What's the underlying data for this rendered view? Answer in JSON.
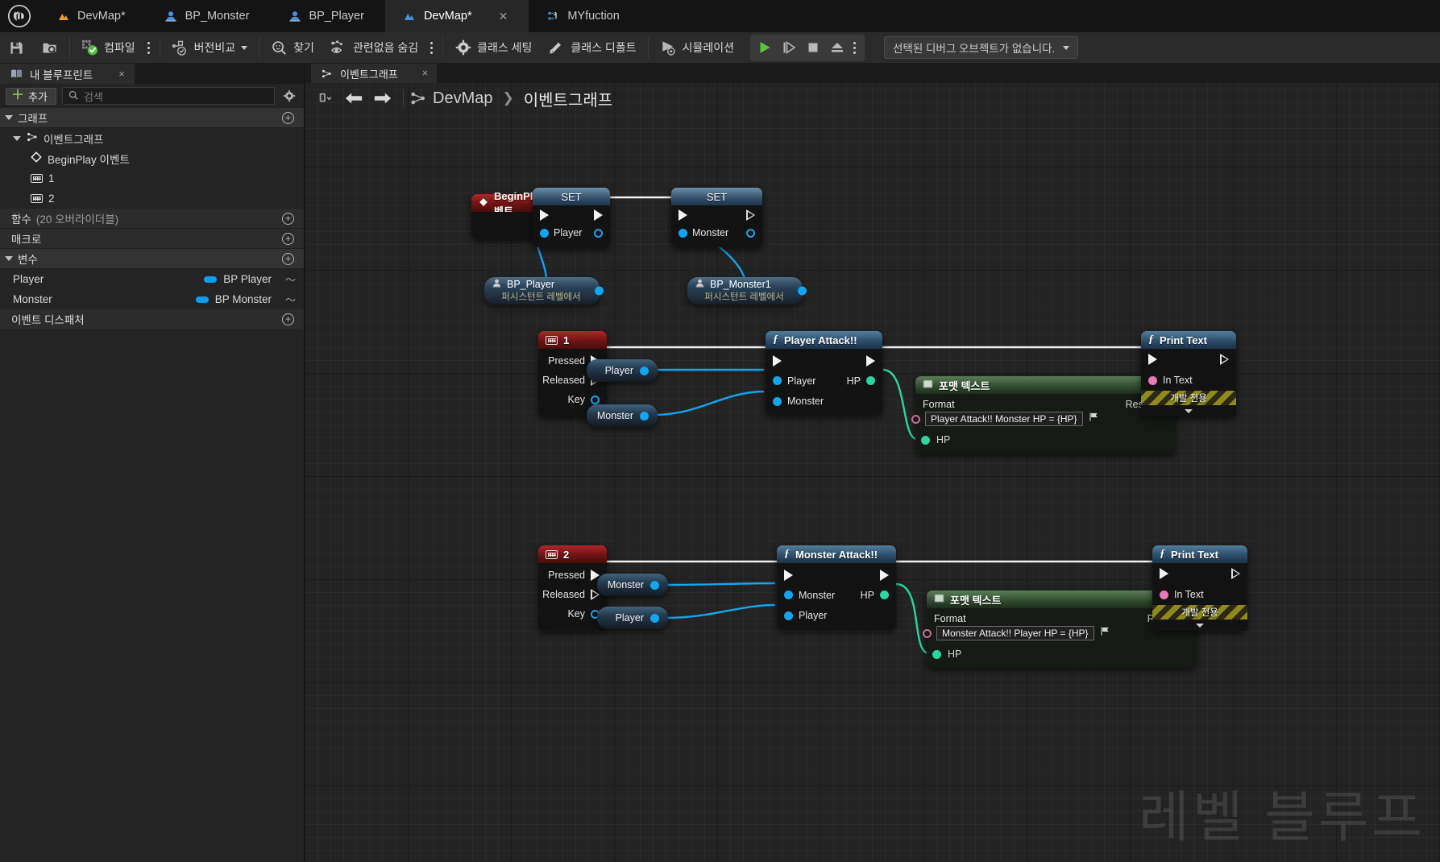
{
  "app": {
    "logo": "unreal-logo"
  },
  "tabs": [
    {
      "label": "DevMap*",
      "icon": "level-icon",
      "active": false,
      "closable": false
    },
    {
      "label": "BP_Monster",
      "icon": "blueprint-actor-icon",
      "active": false,
      "closable": false
    },
    {
      "label": "BP_Player",
      "icon": "blueprint-actor-icon",
      "active": false,
      "closable": false
    },
    {
      "label": "DevMap*",
      "icon": "level-icon",
      "active": true,
      "closable": true
    },
    {
      "label": "MYfuction",
      "icon": "blueprint-function-icon",
      "active": false,
      "closable": false
    }
  ],
  "toolbar": {
    "save_icon": "save-icon",
    "browse_icon": "browse-content-icon",
    "compile_label": "컴파일",
    "compile_icon": "compile-icon",
    "diff_label": "버전비교",
    "diff_icon": "diff-icon",
    "find_label": "찾기",
    "find_icon": "search-icon",
    "hide_unrelated_label": "관련없음 숨김",
    "hide_unrelated_icon": "hide-unrelated-icon",
    "class_settings_label": "클래스 세팅",
    "class_settings_icon": "gear-icon",
    "class_defaults_label": "클래스 디폴트",
    "class_defaults_icon": "class-defaults-icon",
    "simulate_label": "시뮬레이션",
    "simulate_icon": "simulate-icon",
    "play_icon": "play-icon",
    "step_icon": "step-icon",
    "stop_icon": "stop-icon",
    "eject_icon": "eject-icon",
    "debug_object_label": "선택된 디버그 오브젝트가 없습니다."
  },
  "left_panel": {
    "tab_label": "내 블루프린트",
    "tab_icon": "my-blueprint-icon",
    "tab_close": "×",
    "add_label": "추가",
    "search_placeholder": "검색",
    "search_value": "",
    "settings_icon": "gear-icon",
    "sections": [
      {
        "title": "그래프",
        "expanded": true,
        "items": [
          {
            "label": "이벤트그래프",
            "icon": "event-graph-icon",
            "indent": 1,
            "expanded": true
          },
          {
            "label": "BeginPlay 이벤트",
            "icon": "event-node-icon",
            "indent": 2
          },
          {
            "label": "1",
            "icon": "keyboard-icon",
            "indent": 2
          },
          {
            "label": "2",
            "icon": "keyboard-icon",
            "indent": 2
          }
        ]
      },
      {
        "title": "함수",
        "sub": "(20 오버라이더블)",
        "expanded": false,
        "items": []
      },
      {
        "title": "매크로",
        "expanded": false,
        "items": []
      },
      {
        "title": "변수",
        "expanded": true,
        "items": [
          {
            "label": "Player",
            "type": "BP Player",
            "indent": 1
          },
          {
            "label": "Monster",
            "type": "BP Monster",
            "indent": 1
          }
        ]
      },
      {
        "title": "이벤트 디스패처",
        "expanded": false,
        "items": []
      }
    ]
  },
  "graph": {
    "tab_label": "이벤트그래프",
    "tab_icon": "event-graph-icon",
    "tab_close": "×",
    "back_icon": "arrow-left-icon",
    "forward_icon": "arrow-right-icon",
    "list_icon": "graph-list-icon",
    "crumb_icon": "event-graph-icon",
    "breadcrumb": [
      "DevMap",
      "이벤트그래프"
    ],
    "breadcrumb_sep": "❯",
    "watermark": "레벨 블루프"
  },
  "nodes": {
    "begin_play": {
      "title": "BeginPlay 이벤트",
      "icon": "event-node-icon",
      "badge": "stop-badge"
    },
    "set_player": {
      "title": "SET",
      "pin": "Player"
    },
    "set_monster": {
      "title": "SET",
      "pin": "Monster"
    },
    "ref_player": {
      "title": "BP_Player",
      "sub": "퍼시스턴트 레벨에서",
      "icon": "actor-icon"
    },
    "ref_monster": {
      "title": "BP_Monster1",
      "sub": "퍼시스턴트 레벨에서",
      "icon": "actor-icon"
    },
    "key1": {
      "title": "1",
      "icon": "keyboard-icon",
      "pins": [
        "Pressed",
        "Released",
        "Key"
      ]
    },
    "key2": {
      "title": "2",
      "icon": "keyboard-icon",
      "pins": [
        "Pressed",
        "Released",
        "Key"
      ]
    },
    "var_player_1": {
      "label": "Player"
    },
    "var_monster_1": {
      "label": "Monster"
    },
    "var_monster_2": {
      "label": "Monster"
    },
    "var_player_2": {
      "label": "Player"
    },
    "player_attack": {
      "title": "Player Attack!!",
      "icon": "function-icon",
      "inputs": [
        "Player",
        "Monster"
      ],
      "output": "HP"
    },
    "monster_attack": {
      "title": "Monster Attack!!",
      "icon": "function-icon",
      "inputs": [
        "Monster",
        "Player"
      ],
      "output": "HP"
    },
    "format_text_1": {
      "title": "포맷 텍스트",
      "icon": "format-text-icon",
      "format_label": "Format",
      "format_value": "Player Attack!! Monster HP = {HP}",
      "result_label": "Result",
      "hp_label": "HP",
      "flag_icon": "flag-icon"
    },
    "format_text_2": {
      "title": "포맷 텍스트",
      "icon": "format-text-icon",
      "format_label": "Format",
      "format_value": "Monster Attack!! Player HP = {HP}",
      "result_label": "Result",
      "hp_label": "HP",
      "flag_icon": "flag-icon"
    },
    "print_text_1": {
      "title": "Print Text",
      "icon": "function-icon",
      "in_text_label": "In Text",
      "dev_only": "개발 전용"
    },
    "print_text_2": {
      "title": "Print Text",
      "icon": "function-icon",
      "in_text_label": "In Text",
      "dev_only": "개발 전용"
    }
  },
  "colors": {
    "exec_wire": "#f2f2f2",
    "object_wire": "#12a5f0",
    "float_wire": "#28d6a0",
    "text_wire": "#e87ab5",
    "accent_blue": "#0e9cf0",
    "green": "#7ec94b"
  }
}
